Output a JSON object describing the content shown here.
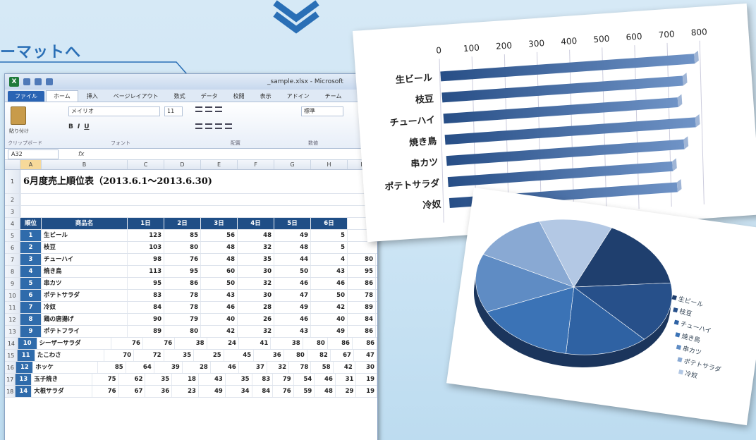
{
  "heading": "ーマットへ",
  "excel": {
    "window_title": "_sample.xlsx - Microsoft",
    "tabs": [
      "ファイル",
      "ホーム",
      "挿入",
      "ページレイアウト",
      "数式",
      "データ",
      "校閲",
      "表示",
      "アドイン",
      "チーム"
    ],
    "ribbon": {
      "paste_label": "貼り付け",
      "font_name": "メイリオ",
      "font_size": "11",
      "number_format": "標準",
      "group_labels": [
        "クリップボード",
        "フォント",
        "配置",
        "数値"
      ]
    },
    "name_box": "A32",
    "fx": "fx",
    "columns": [
      "A",
      "B",
      "C",
      "D",
      "E",
      "F",
      "G",
      "H",
      "I"
    ],
    "sheet_title": "6月度売上順位表（2013.6.1～2013.6.30)",
    "table_headers": [
      "順位",
      "商品名",
      "1日",
      "2日",
      "3日",
      "4日",
      "5日",
      "6日"
    ],
    "rows": [
      {
        "rn": "5",
        "rank": "1",
        "name": "生ビール",
        "d": [
          "123",
          "85",
          "56",
          "48",
          "49",
          "5"
        ]
      },
      {
        "rn": "6",
        "rank": "2",
        "name": "枝豆",
        "d": [
          "103",
          "80",
          "48",
          "32",
          "48",
          "5"
        ]
      },
      {
        "rn": "7",
        "rank": "3",
        "name": "チューハイ",
        "d": [
          "98",
          "76",
          "48",
          "35",
          "44",
          "4"
        ]
      },
      {
        "rn": "8",
        "rank": "4",
        "name": "焼き鳥",
        "d": [
          "113",
          "95",
          "60",
          "30",
          "50",
          "43"
        ]
      },
      {
        "rn": "9",
        "rank": "5",
        "name": "串カツ",
        "d": [
          "95",
          "86",
          "50",
          "32",
          "46",
          "46"
        ]
      },
      {
        "rn": "10",
        "rank": "6",
        "name": "ポテトサラダ",
        "d": [
          "83",
          "78",
          "43",
          "30",
          "47",
          "50"
        ]
      },
      {
        "rn": "11",
        "rank": "7",
        "name": "冷奴",
        "d": [
          "84",
          "78",
          "46",
          "28",
          "49",
          "42"
        ]
      },
      {
        "rn": "12",
        "rank": "8",
        "name": "鶏の唐揚げ",
        "d": [
          "90",
          "79",
          "40",
          "26",
          "46",
          "40"
        ]
      },
      {
        "rn": "13",
        "rank": "9",
        "name": "ポテトフライ",
        "d": [
          "89",
          "80",
          "42",
          "32",
          "43",
          "49"
        ]
      },
      {
        "rn": "14",
        "rank": "10",
        "name": "シーザーサラダ",
        "d": [
          "76",
          "76",
          "38",
          "24",
          "41",
          "38"
        ]
      },
      {
        "rn": "15",
        "rank": "11",
        "name": "たこわさ",
        "d": [
          "70",
          "72",
          "35",
          "25",
          "45",
          "36"
        ]
      },
      {
        "rn": "16",
        "rank": "12",
        "name": "ホッケ",
        "d": [
          "85",
          "64",
          "39",
          "28",
          "46",
          "37"
        ]
      },
      {
        "rn": "17",
        "rank": "13",
        "name": "玉子焼き",
        "d": [
          "75",
          "62",
          "35",
          "18",
          "43",
          "35"
        ]
      },
      {
        "rn": "18",
        "rank": "14",
        "name": "大根サラダ",
        "d": [
          "76",
          "67",
          "36",
          "23",
          "49",
          "34"
        ]
      }
    ],
    "extra_cols": [
      {
        "rn": "7",
        "v": [
          "80"
        ]
      },
      {
        "rn": "8",
        "v": [
          "95"
        ]
      },
      {
        "rn": "9",
        "v": [
          "86"
        ]
      },
      {
        "rn": "10",
        "v": [
          "78"
        ]
      },
      {
        "rn": "11",
        "v": [
          "89"
        ]
      },
      {
        "rn": "12",
        "v": [
          "84"
        ]
      },
      {
        "rn": "13",
        "v": [
          "86"
        ]
      },
      {
        "rn": "14",
        "v": [
          "80",
          "86",
          "86"
        ]
      },
      {
        "rn": "15",
        "v": [
          "80",
          "82",
          "67",
          "47"
        ]
      },
      {
        "rn": "16",
        "v": [
          "32",
          "78",
          "58",
          "42",
          "30"
        ]
      },
      {
        "rn": "17",
        "v": [
          "83",
          "79",
          "54",
          "46",
          "31",
          "19"
        ]
      },
      {
        "rn": "18",
        "v": [
          "84",
          "76",
          "59",
          "48",
          "29",
          "19"
        ]
      }
    ]
  },
  "chart_data": [
    {
      "type": "bar",
      "categories": [
        "生ビール",
        "枝豆",
        "チューハイ",
        "焼き鳥",
        "串カツ",
        "ポテトサラダ",
        "冷奴"
      ],
      "values": [
        780,
        740,
        720,
        770,
        730,
        690,
        700
      ],
      "xlim": [
        0,
        800
      ],
      "xticks": [
        "0",
        "100",
        "200",
        "300",
        "400",
        "500",
        "600",
        "700",
        "800"
      ]
    },
    {
      "type": "pie",
      "labels": [
        "生ビール",
        "枝豆",
        "チューハイ",
        "焼き鳥",
        "串カツ",
        "ポテトサラダ",
        "冷奴"
      ],
      "values": [
        16,
        15,
        14,
        16,
        14,
        13,
        12
      ],
      "colors": [
        "#1f3f6e",
        "#27508a",
        "#2f62a3",
        "#3b73b6",
        "#5f8cc4",
        "#89a9d3",
        "#b3c8e4"
      ]
    }
  ]
}
